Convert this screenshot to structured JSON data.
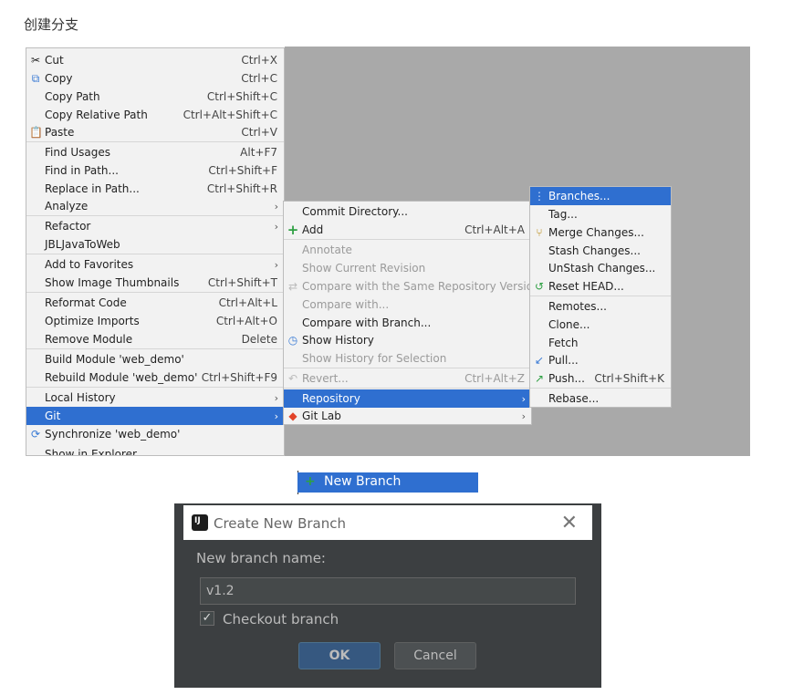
{
  "title": "创建分支",
  "main_menu": {
    "items": [
      {
        "label": "Cut",
        "shortcut": "Ctrl+X",
        "icon": "scissors-icon"
      },
      {
        "label": "Copy",
        "shortcut": "Ctrl+C",
        "icon": "copy-icon"
      },
      {
        "label": "Copy Path",
        "shortcut": "Ctrl+Shift+C"
      },
      {
        "label": "Copy Relative Path",
        "shortcut": "Ctrl+Alt+Shift+C"
      },
      {
        "label": "Paste",
        "shortcut": "Ctrl+V",
        "icon": "paste-icon"
      },
      {
        "label": "Find Usages",
        "shortcut": "Alt+F7"
      },
      {
        "label": "Find in Path...",
        "shortcut": "Ctrl+Shift+F"
      },
      {
        "label": "Replace in Path...",
        "shortcut": "Ctrl+Shift+R"
      },
      {
        "label": "Analyze",
        "shortcut": ""
      },
      {
        "label": "Refactor",
        "shortcut": ""
      },
      {
        "label": "JBLJavaToWeb",
        "shortcut": ""
      },
      {
        "label": "Add to Favorites",
        "shortcut": ""
      },
      {
        "label": "Show Image Thumbnails",
        "shortcut": "Ctrl+Shift+T"
      },
      {
        "label": "Reformat Code",
        "shortcut": "Ctrl+Alt+L"
      },
      {
        "label": "Optimize Imports",
        "shortcut": "Ctrl+Alt+O"
      },
      {
        "label": "Remove Module",
        "shortcut": "Delete"
      },
      {
        "label": "Build Module 'web_demo'",
        "shortcut": ""
      },
      {
        "label": "Rebuild Module 'web_demo'",
        "shortcut": "Ctrl+Shift+F9"
      },
      {
        "label": "Local History",
        "shortcut": ""
      },
      {
        "label": "Git",
        "shortcut": ""
      },
      {
        "label": "Synchronize 'web_demo'",
        "shortcut": "",
        "icon": "sync-icon"
      },
      {
        "label": "Show in Explorer",
        "shortcut": ""
      }
    ]
  },
  "git_menu": {
    "items": [
      {
        "label": "Commit Directory...",
        "shortcut": ""
      },
      {
        "label": "Add",
        "shortcut": "Ctrl+Alt+A",
        "icon": "plus-icon"
      },
      {
        "label": "Annotate",
        "shortcut": ""
      },
      {
        "label": "Show Current Revision",
        "shortcut": ""
      },
      {
        "label": "Compare with the Same Repository Version",
        "shortcut": ""
      },
      {
        "label": "Compare with...",
        "shortcut": ""
      },
      {
        "label": "Compare with Branch...",
        "shortcut": ""
      },
      {
        "label": "Show History",
        "shortcut": "",
        "icon": "history-icon"
      },
      {
        "label": "Show History for Selection",
        "shortcut": ""
      },
      {
        "label": "Revert...",
        "shortcut": "Ctrl+Alt+Z",
        "icon": "revert-icon"
      },
      {
        "label": "Repository",
        "shortcut": ""
      },
      {
        "label": "Git Lab",
        "shortcut": "",
        "icon": "gitlab-icon"
      }
    ]
  },
  "repo_menu": {
    "items": [
      {
        "label": "Branches...",
        "shortcut": "",
        "icon": "branch-icon"
      },
      {
        "label": "Tag...",
        "shortcut": ""
      },
      {
        "label": "Merge Changes...",
        "shortcut": "",
        "icon": "merge-icon"
      },
      {
        "label": "Stash Changes...",
        "shortcut": ""
      },
      {
        "label": "UnStash Changes...",
        "shortcut": ""
      },
      {
        "label": "Reset HEAD...",
        "shortcut": "",
        "icon": "reset-icon"
      },
      {
        "label": "Remotes...",
        "shortcut": ""
      },
      {
        "label": "Clone...",
        "shortcut": ""
      },
      {
        "label": "Fetch",
        "shortcut": ""
      },
      {
        "label": "Pull...",
        "shortcut": "",
        "icon": "pull-icon"
      },
      {
        "label": "Push...",
        "shortcut": "Ctrl+Shift+K",
        "icon": "push-icon"
      },
      {
        "label": "Rebase...",
        "shortcut": ""
      }
    ]
  },
  "new_branch_item": {
    "label": "New Branch",
    "icon": "plus-icon"
  },
  "dialog": {
    "title": "Create New Branch",
    "field_label": "New branch name:",
    "field_value": "v1.2",
    "checkbox_label": "Checkout branch",
    "checkbox_checked": true,
    "ok_label": "OK",
    "cancel_label": "Cancel"
  }
}
